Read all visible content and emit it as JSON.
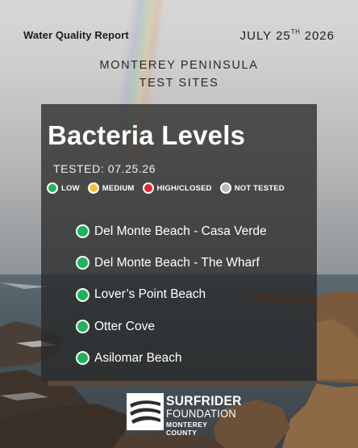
{
  "header": {
    "report_title": "Water Quality Report",
    "date_prefix": "JULY 25",
    "date_suffix": "TH",
    "date_year": "2026"
  },
  "subtitle": {
    "line1": "MONTEREY PENINSULA",
    "line2": "TEST SITES"
  },
  "panel": {
    "title": "Bacteria Levels",
    "tested": "TESTED: 07.25.26"
  },
  "legend": [
    {
      "label": "LOW",
      "color": "#22b35a"
    },
    {
      "label": "MEDIUM",
      "color": "#f4c238"
    },
    {
      "label": "HIGH/CLOSED",
      "color": "#e5252b"
    },
    {
      "label": "NOT TESTED",
      "color": "#b7b7b7"
    }
  ],
  "sites": [
    {
      "name": "Del Monte Beach - Casa Verde",
      "color": "#22b35a"
    },
    {
      "name": "Del Monte Beach - The Wharf",
      "color": "#22b35a"
    },
    {
      "name": "Lover’s Point Beach",
      "color": "#22b35a"
    },
    {
      "name": "Otter Cove",
      "color": "#22b35a"
    },
    {
      "name": "Asilomar Beach",
      "color": "#22b35a"
    }
  ],
  "logo": {
    "line1": "SURFRIDER",
    "line2": "FOUNDATION",
    "line3": "MONTEREY COUNTY"
  }
}
